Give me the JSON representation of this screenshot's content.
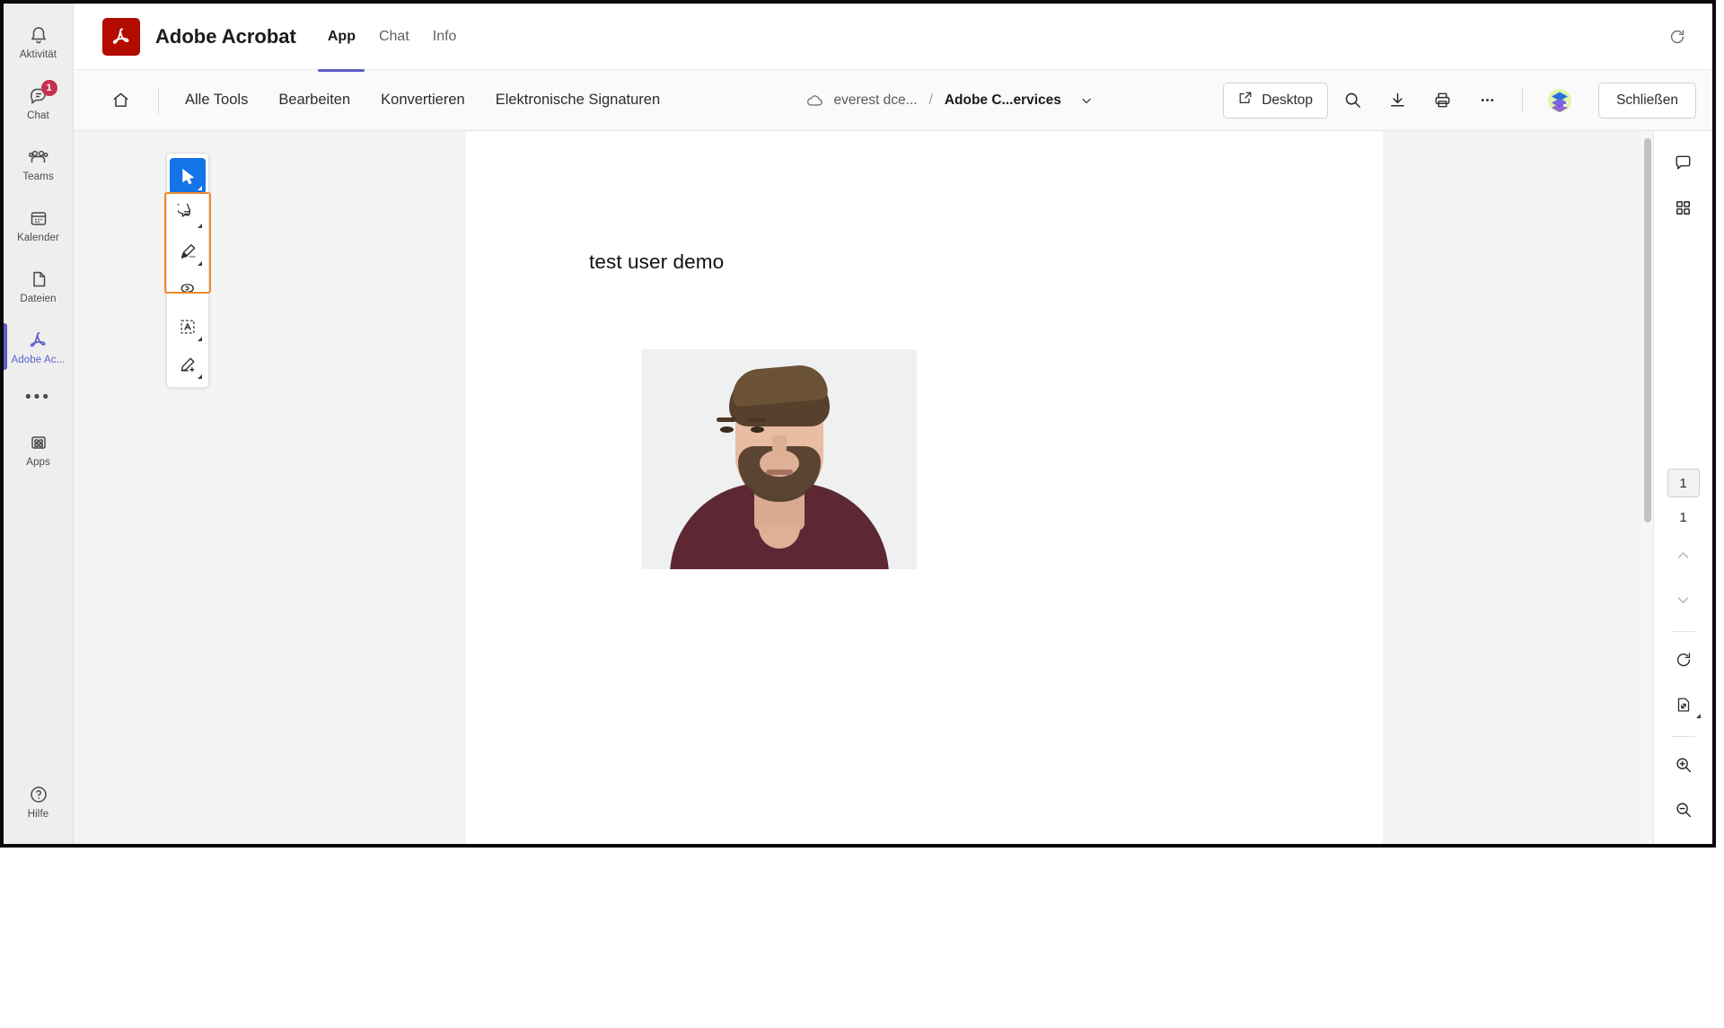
{
  "teams_rail": {
    "items": [
      {
        "label": "Aktivität",
        "icon": "bell-icon",
        "badge": null,
        "active": false
      },
      {
        "label": "Chat",
        "icon": "chat-icon",
        "badge": "1",
        "active": false
      },
      {
        "label": "Teams",
        "icon": "teams-icon",
        "badge": null,
        "active": false
      },
      {
        "label": "Kalender",
        "icon": "calendar-icon",
        "badge": null,
        "active": false
      },
      {
        "label": "Dateien",
        "icon": "files-icon",
        "badge": null,
        "active": false
      },
      {
        "label": "Adobe Ac...",
        "icon": "adobe-acrobat-icon",
        "badge": null,
        "active": true
      }
    ],
    "overflow_label": "•••",
    "apps": {
      "label": "Apps",
      "icon": "apps-grid-icon"
    },
    "help": {
      "label": "Hilfe",
      "icon": "help-circle-icon"
    },
    "accent_color": "#5b5fc7",
    "badge_color": "#c4314b"
  },
  "header": {
    "app_title": "Adobe Acrobat",
    "logo_icon": "adobe-acrobat-logo",
    "logo_color": "#b30b00",
    "tabs": [
      {
        "label": "App",
        "active": true
      },
      {
        "label": "Chat",
        "active": false
      },
      {
        "label": "Info",
        "active": false
      }
    ],
    "refresh_icon": "refresh-icon"
  },
  "toolbar": {
    "home_icon": "home-icon",
    "menus": [
      {
        "label": "Alle Tools"
      },
      {
        "label": "Bearbeiten"
      },
      {
        "label": "Konvertieren"
      },
      {
        "label": "Elektronische Signaturen"
      }
    ],
    "breadcrumb": {
      "cloud_icon": "cloud-icon",
      "folder": "everest dce...",
      "separator": "/",
      "file": "Adobe C...ervices",
      "chevron_icon": "chevron-down-icon"
    },
    "desktop_button": {
      "label": "Desktop",
      "icon": "external-link-icon"
    },
    "actions": [
      {
        "name": "search-icon",
        "title": "Suchen"
      },
      {
        "name": "download-icon",
        "title": "Herunterladen"
      },
      {
        "name": "print-icon",
        "title": "Drucken"
      },
      {
        "name": "more-icon",
        "title": "Mehr"
      }
    ],
    "ai_assistant_icon": "ai-assistant-icon",
    "close_button": "Schließen"
  },
  "tool_palette": {
    "highlight_color": "#ef8b2c",
    "active_color": "#1473e6",
    "tools": [
      {
        "name": "select-cursor-tool",
        "icon": "cursor-icon",
        "active": true,
        "caret": true
      },
      {
        "name": "comment-tool",
        "icon": "comment-bubble-icon",
        "active": false,
        "caret": true
      },
      {
        "name": "highlight-tool",
        "icon": "highlighter-pen-icon",
        "active": false,
        "caret": true
      },
      {
        "name": "draw-tool",
        "icon": "lasso-loop-icon",
        "active": false,
        "caret": false
      },
      {
        "name": "text-box-tool",
        "icon": "text-box-icon",
        "active": false,
        "caret": true
      },
      {
        "name": "signature-tool",
        "icon": "signature-pen-icon",
        "active": false,
        "caret": true
      }
    ]
  },
  "document": {
    "heading": "test user demo",
    "photo_alt": "portrait-photo-of-bearded-man"
  },
  "right_rail": {
    "top_buttons": [
      {
        "name": "comments-panel-button",
        "icon": "comment-bubble-icon"
      },
      {
        "name": "thumbnails-panel-button",
        "icon": "grid-thumbnails-icon"
      }
    ],
    "current_page": "1",
    "total_pages": "1",
    "prev_icon": "chevron-up-icon",
    "next_icon": "chevron-down-icon",
    "rotate_icon": "rotate-clockwise-icon",
    "fit_page_icon": "fit-page-icon",
    "zoom_in_icon": "zoom-in-icon",
    "zoom_out_icon": "zoom-out-icon"
  }
}
